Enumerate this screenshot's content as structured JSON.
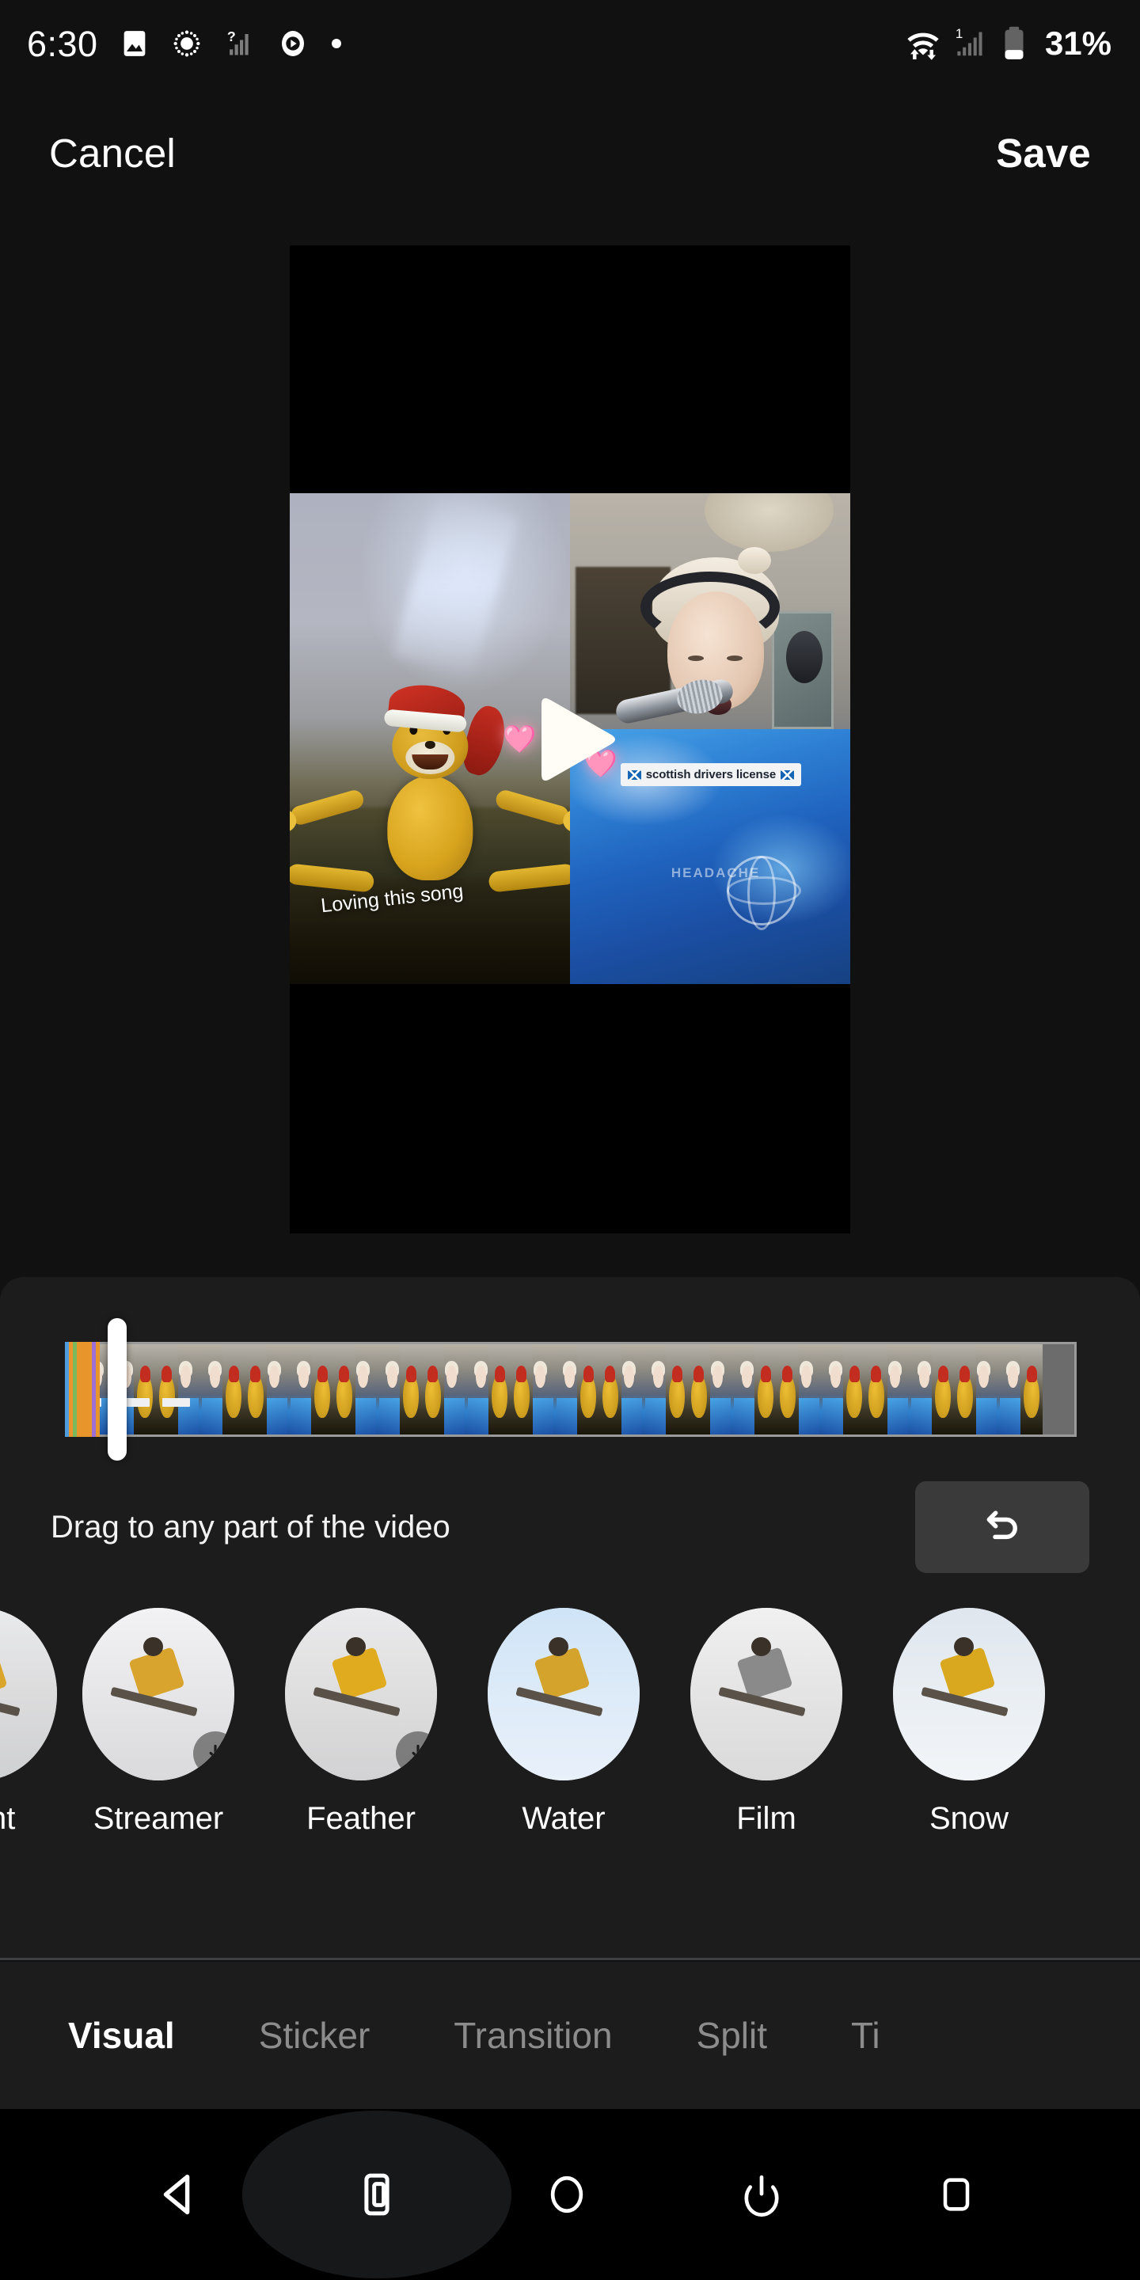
{
  "status_bar": {
    "time": "6:30",
    "battery_percent": "31%",
    "left_icons": [
      "image-icon",
      "brightness-icon",
      "signal-question-icon",
      "play-circle-icon",
      "dot-icon"
    ],
    "right_icons": [
      "wifi-transfer-icon",
      "cellular-signal-1-icon",
      "battery-icon"
    ],
    "signal_label": "1"
  },
  "header": {
    "cancel_label": "Cancel",
    "save_label": "Save"
  },
  "preview": {
    "play_icon": "play-triangle-icon",
    "left_clip": {
      "caption": "Loving this song",
      "heart_emoji": "🩷"
    },
    "right_clip": {
      "sticker_text": "scottish drivers license",
      "sticker_flag": "scotland-flag-icon",
      "shirt_text": "HEADACHE",
      "heart_emoji": "🩷"
    }
  },
  "timeline": {
    "playhead_label": "playhead",
    "frame_count": 22,
    "hint_text": "Drag to any part of the video",
    "undo_icon": "undo-arrow-icon",
    "stripe_colors": [
      "#4f9ddd",
      "#e8962b",
      "#79b85c",
      "#e8962b",
      "#e8962b",
      "#e8962b",
      "#e8962b",
      "#9b6fd4",
      "#e8962b"
    ]
  },
  "effects": [
    {
      "label": "rlight",
      "full_label": "Starlight",
      "partial": true,
      "has_download_badge": false,
      "sky": "linear-gradient(180deg,#e9eaec 0%,#dcdcdd 48%,#cfd0d2 100%)",
      "skier_color": "#d9a62b"
    },
    {
      "label": "Streamer",
      "partial": false,
      "has_download_badge": true,
      "sky": "linear-gradient(180deg,#f2f2f4 0%,#e6e6e8 50%,#dadadc 100%)",
      "skier_color": "#d8a42d"
    },
    {
      "label": "Feather",
      "partial": false,
      "has_download_badge": true,
      "sky": "linear-gradient(180deg,#eaeaec 0%,#dedede 50%,#d2d2d4 100%)",
      "skier_color": "#e0ab1e"
    },
    {
      "label": "Water",
      "partial": false,
      "has_download_badge": false,
      "sky": "linear-gradient(180deg,#cfe4f7 0%,#dceaf8 45%,#e8f0fa 100%)",
      "skier_color": "#d4a32c"
    },
    {
      "label": "Film",
      "partial": false,
      "has_download_badge": false,
      "sky": "linear-gradient(180deg,#f0f0f0 0%,#e4e4e4 50%,#dadada 100%)",
      "skier_color": "#8a8a8a"
    },
    {
      "label": "Snow",
      "partial": false,
      "has_download_badge": false,
      "sky": "linear-gradient(180deg,#dfe6ee 0%,#e9eef3 50%,#f2f5f8 100%)",
      "skier_color": "#d9a81f"
    }
  ],
  "tabs": [
    {
      "label": "Visual",
      "active": true
    },
    {
      "label": "Sticker",
      "active": false
    },
    {
      "label": "Transition",
      "active": false
    },
    {
      "label": "Split",
      "active": false
    },
    {
      "label": "Ti",
      "active": false
    }
  ],
  "nav_bar": {
    "back_icon": "back-triangle-icon",
    "cast_icon": "device-screenshot-icon",
    "home_icon": "home-circle-icon",
    "power_icon": "power-icon",
    "recents_icon": "recents-square-icon"
  },
  "colors": {
    "page_bg": "#111112",
    "panel_bg": "#1c1c1d",
    "accent_white": "#ffffff",
    "muted_text": "#8c8c8c",
    "undo_bg": "#3a3a3a",
    "divider": "#3d3f41"
  }
}
